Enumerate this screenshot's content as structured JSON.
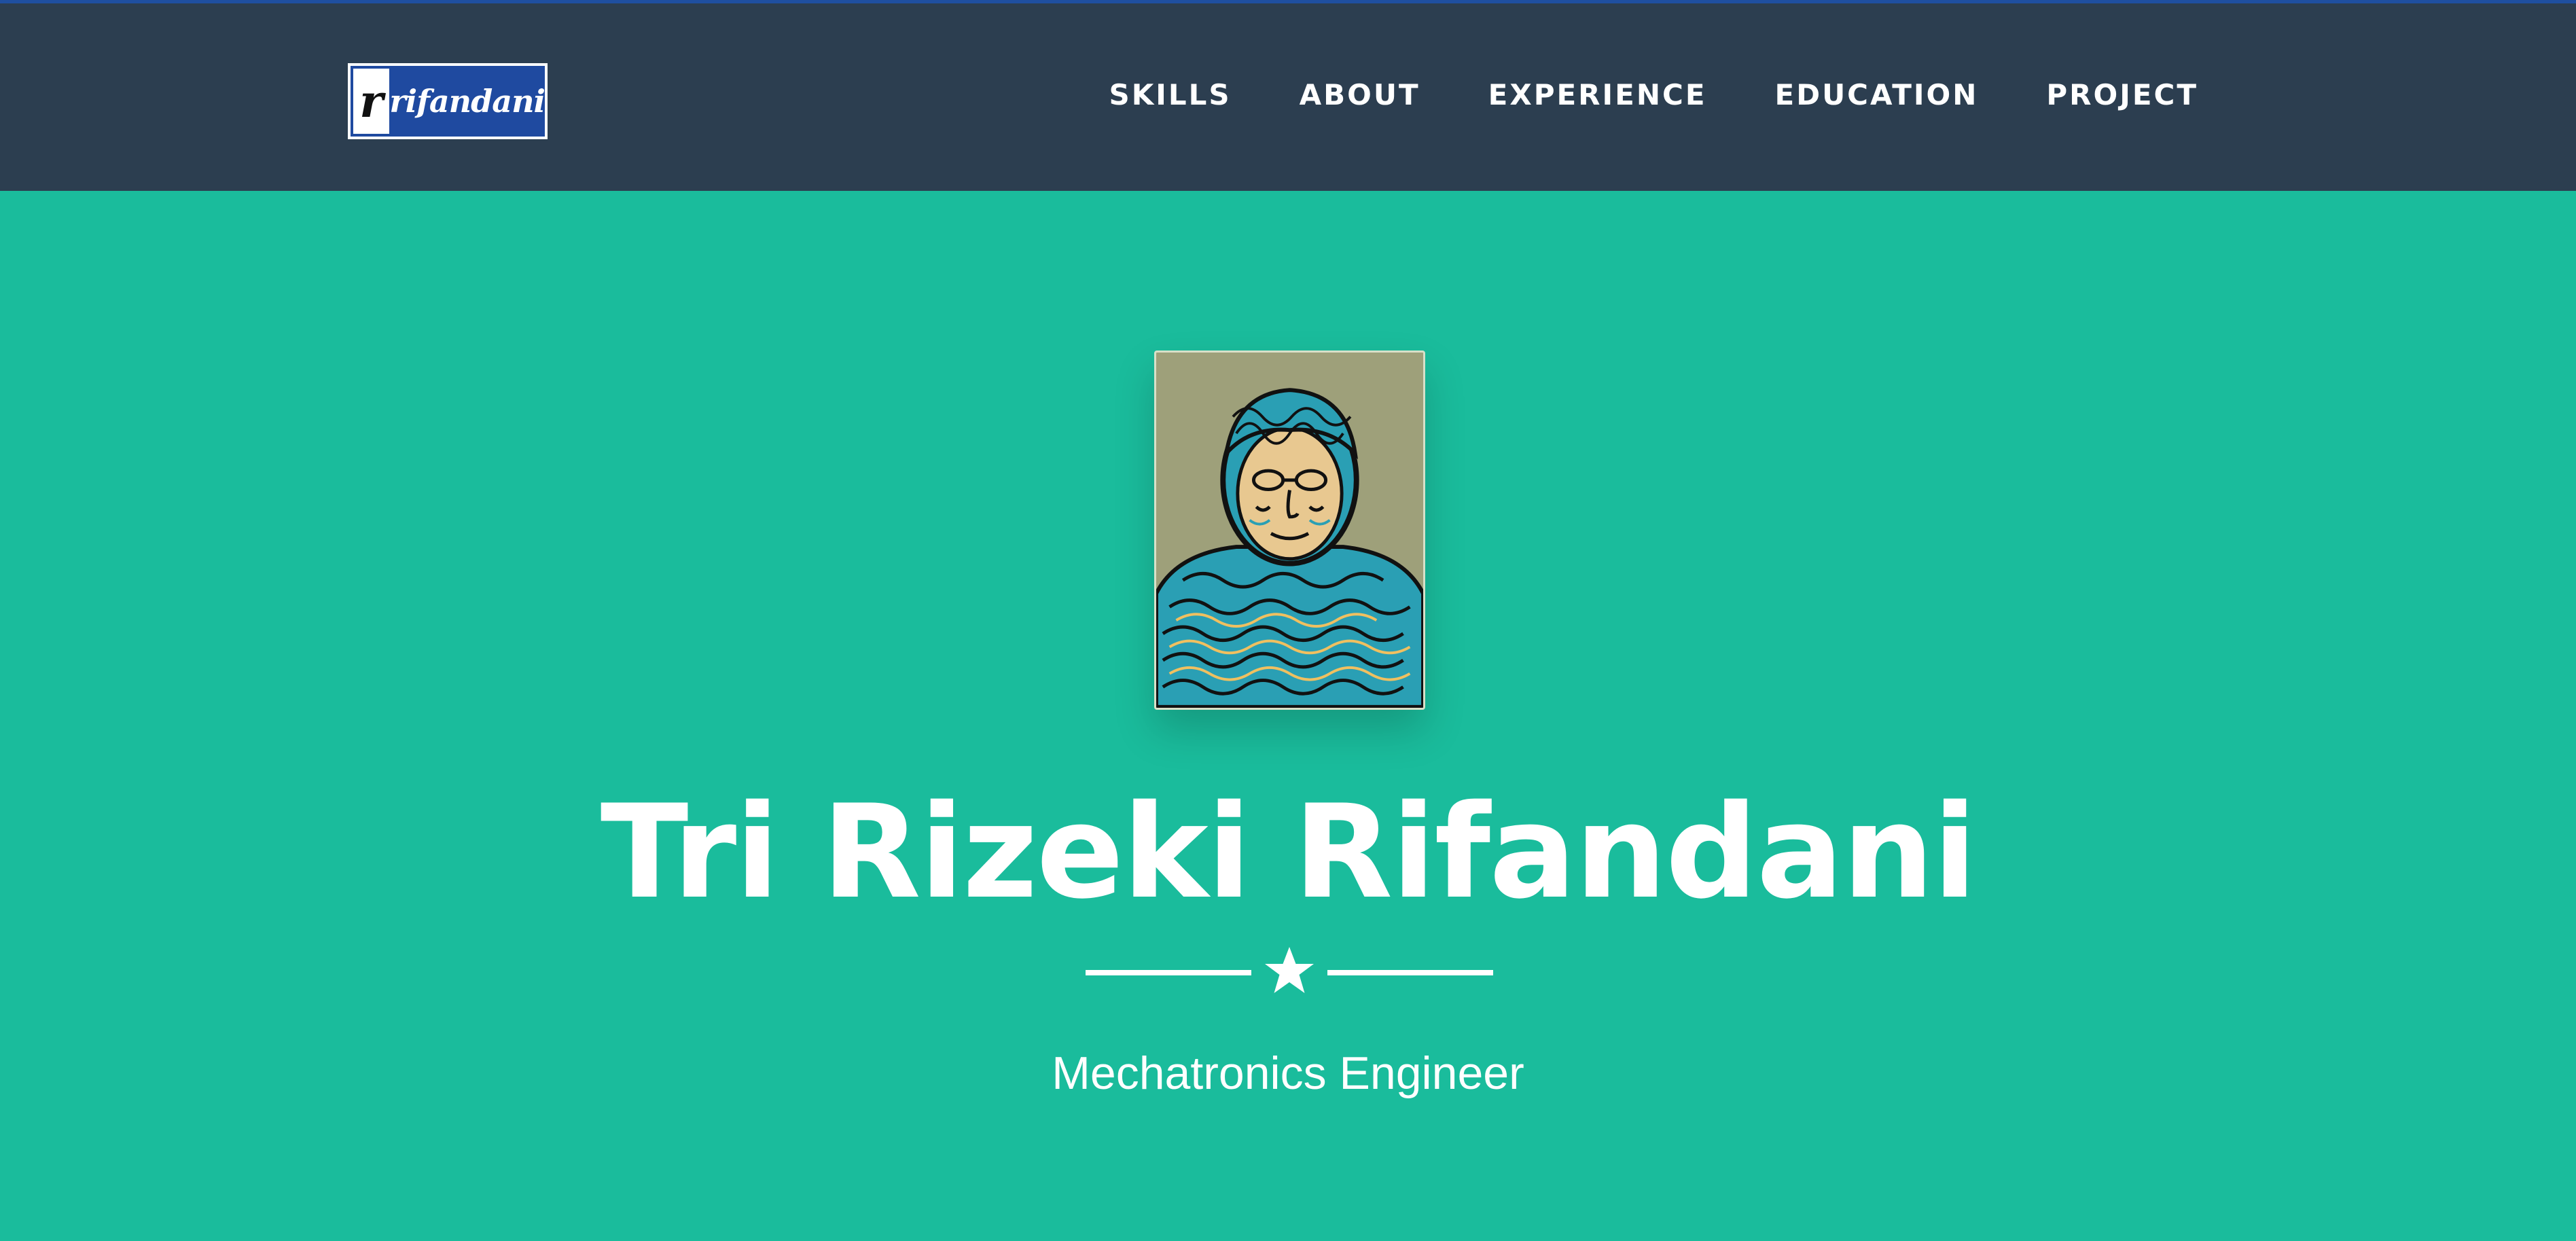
{
  "brand": {
    "mark": "r",
    "text": "rifandani"
  },
  "nav": {
    "items": [
      {
        "label": "SKILLS"
      },
      {
        "label": "ABOUT"
      },
      {
        "label": "EXPERIENCE"
      },
      {
        "label": "EDUCATION"
      },
      {
        "label": "PROJECT"
      }
    ]
  },
  "hero": {
    "avatar_alt": "profile-portrait",
    "name": "Tri Rizeki Rifandani",
    "divider_icon": "star-icon",
    "subtitle": "Mechatronics Engineer"
  },
  "colors": {
    "navbar": "#2c3e50",
    "hero": "#1abc9c",
    "accent": "#1f4fa0",
    "brand_bg": "#1f4aa0",
    "text": "#ffffff"
  }
}
